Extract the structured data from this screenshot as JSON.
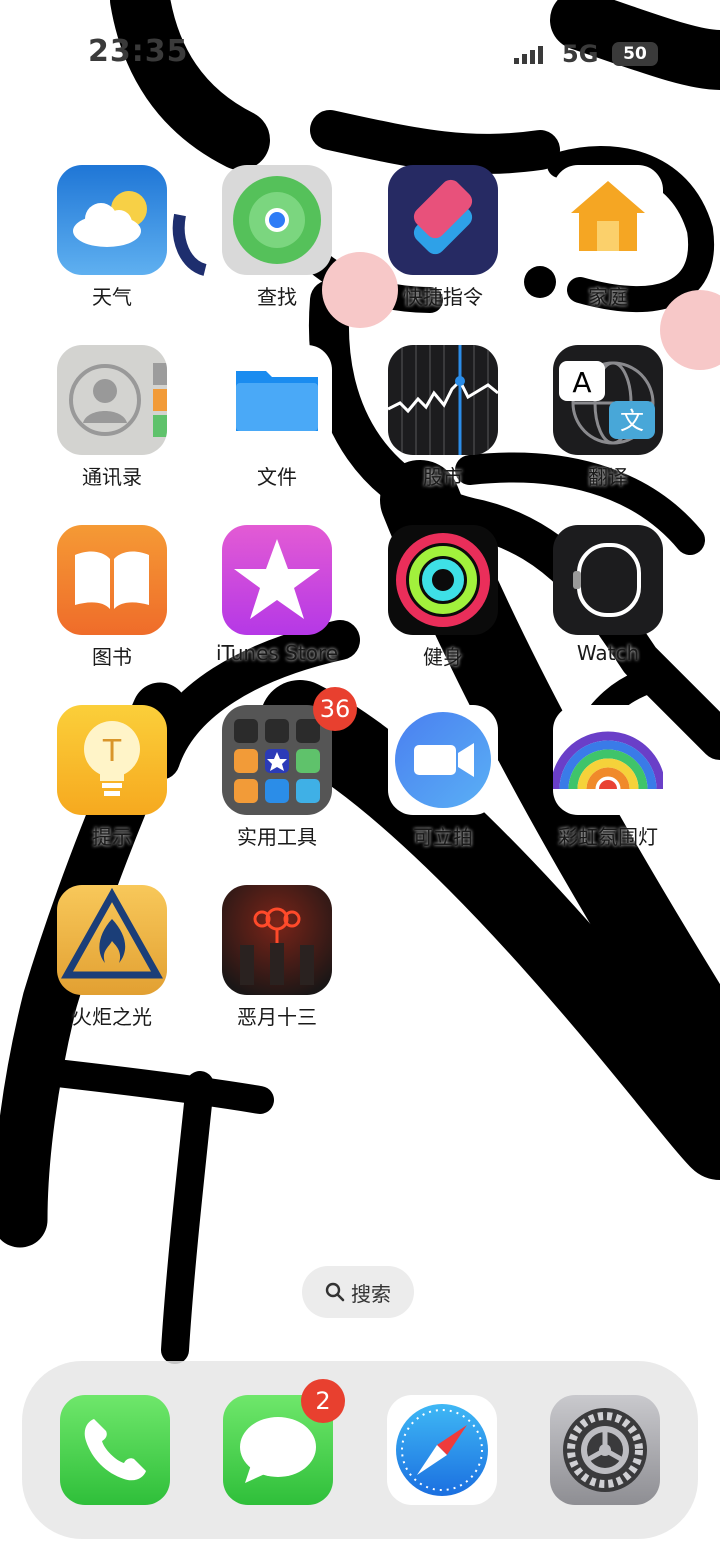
{
  "status_bar": {
    "time": "23:35",
    "network": "5G",
    "battery": "50"
  },
  "apps": [
    {
      "label": "天气",
      "icon": "weather-icon"
    },
    {
      "label": "查找",
      "icon": "find-my-icon"
    },
    {
      "label": "快捷指令",
      "icon": "shortcuts-icon"
    },
    {
      "label": "家庭",
      "icon": "home-icon"
    },
    {
      "label": "通讯录",
      "icon": "contacts-icon"
    },
    {
      "label": "文件",
      "icon": "files-icon"
    },
    {
      "label": "股市",
      "icon": "stocks-icon"
    },
    {
      "label": "翻译",
      "icon": "translate-icon"
    },
    {
      "label": "图书",
      "icon": "books-icon"
    },
    {
      "label": "iTunes Store",
      "icon": "itunes-store-icon"
    },
    {
      "label": "健身",
      "icon": "fitness-icon"
    },
    {
      "label": "Watch",
      "icon": "watch-icon"
    },
    {
      "label": "提示",
      "icon": "tips-icon"
    },
    {
      "label": "实用工具",
      "icon": "utilities-folder-icon",
      "badge": "36"
    },
    {
      "label": "可立拍",
      "icon": "clips-icon"
    },
    {
      "label": "彩虹氛围灯",
      "icon": "rainbow-lamp-icon"
    },
    {
      "label": "火炬之光",
      "icon": "torchlight-game-icon"
    },
    {
      "label": "恶月十三",
      "icon": "evil-month-game-icon"
    }
  ],
  "translate_icon_letters": {
    "a": "A",
    "b": "文"
  },
  "tips_letter": "T",
  "search": {
    "label": "搜索"
  },
  "dock": [
    {
      "name": "phone",
      "icon": "phone-icon"
    },
    {
      "name": "messages",
      "icon": "messages-icon",
      "badge": "2"
    },
    {
      "name": "safari",
      "icon": "safari-icon"
    },
    {
      "name": "settings",
      "icon": "settings-icon"
    }
  ]
}
